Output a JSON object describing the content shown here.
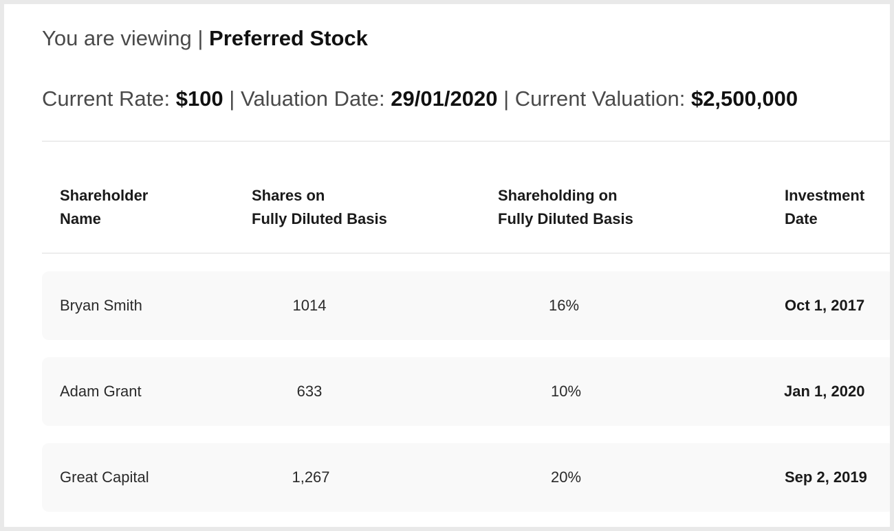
{
  "header": {
    "viewing_prefix": "You are viewing |",
    "stock_class": "Preferred Stock"
  },
  "summary": {
    "rate_label": "Current Rate:",
    "rate_value": "$100",
    "sep1": "|",
    "date_label": "Valuation Date:",
    "date_value": "29/01/2020",
    "sep2": "|",
    "valuation_label": "Current Valuation:",
    "valuation_value": "$2,500,000"
  },
  "table": {
    "columns": [
      {
        "line1": "Shareholder",
        "line2": "Name"
      },
      {
        "line1": "Shares on",
        "line2": "Fully Diluted Basis"
      },
      {
        "line1": "Shareholding on",
        "line2": "Fully Diluted Basis"
      },
      {
        "line1": "Investment",
        "line2": "Date"
      }
    ],
    "rows": [
      {
        "name": "Bryan Smith",
        "shares": "1014",
        "holding": "16%",
        "date": "Oct 1, 2017"
      },
      {
        "name": "Adam Grant",
        "shares": "633",
        "holding": "10%",
        "date": "Jan 1, 2020"
      },
      {
        "name": "Great Capital",
        "shares": "1,267",
        "holding": "20%",
        "date": "Sep 2, 2019"
      }
    ]
  }
}
